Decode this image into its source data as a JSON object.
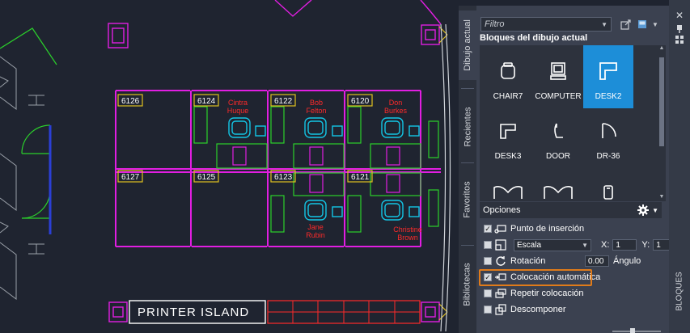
{
  "drawing": {
    "room_labels": [
      "6126",
      "6124",
      "6122",
      "6120",
      "6127",
      "6125",
      "6123",
      "6121"
    ],
    "person_names": [
      [
        "Cintra",
        "Huque"
      ],
      [
        "Bob",
        "Felton"
      ],
      [
        "Don",
        "Burkes"
      ],
      [
        "Jane",
        "Rubin"
      ],
      [
        "Christine",
        "Brown"
      ]
    ],
    "island_label": "PRINTER ISLAND"
  },
  "palette": {
    "tabs": [
      "Dibujo actual",
      "Recientes",
      "Favoritos",
      "Bibliotecas"
    ],
    "active_tab": "Dibujo actual",
    "filter_placeholder": "Filtro",
    "section_title": "Bloques del dibujo actual",
    "blocks": [
      {
        "label": "CHAIR7",
        "icon": "chair-icon",
        "selected": false
      },
      {
        "label": "COMPUTER",
        "icon": "computer-icon",
        "selected": false
      },
      {
        "label": "DESK2",
        "icon": "desk-icon",
        "selected": true
      },
      {
        "label": "DESK3",
        "icon": "desk-icon",
        "selected": false
      },
      {
        "label": "DOOR",
        "icon": "door-icon",
        "selected": false
      },
      {
        "label": "DR-36",
        "icon": "door-swing-icon",
        "selected": false
      }
    ],
    "options": {
      "title": "Opciones",
      "insertion_point": {
        "label": "Punto de inserción",
        "checked": true
      },
      "scale": {
        "label": "Escala",
        "checked": false,
        "x_label": "X:",
        "x_value": "1",
        "y_label": "Y:",
        "y_value": "1"
      },
      "rotation": {
        "label": "Rotación",
        "checked": false,
        "value": "0.00",
        "unit_label": "Ángulo"
      },
      "auto_placement": {
        "label": "Colocación automática",
        "checked": true
      },
      "repeat_placement": {
        "label": "Repetir colocación",
        "checked": false
      },
      "explode": {
        "label": "Descomponer",
        "checked": false
      }
    },
    "vertical_title": "BLOQUES"
  },
  "colors": {
    "accent_blue": "#1d8ed8",
    "highlight_orange": "#e07b1a",
    "walls_magenta": "#e11ee1",
    "desks_green": "#2bd12b",
    "labels_yellow": "#e0c020",
    "names_red": "#ff2a2a",
    "chairs_cyan": "#13c6e6"
  }
}
